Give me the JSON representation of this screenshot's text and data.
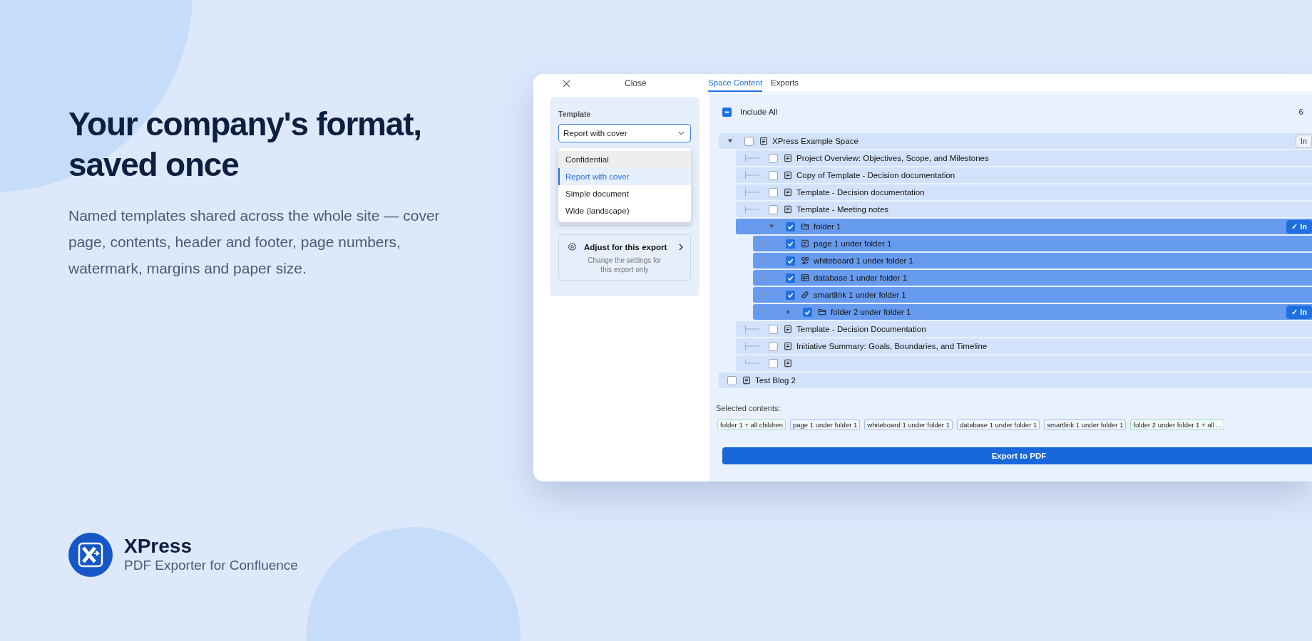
{
  "hero": {
    "title": "Your company's format, saved once",
    "text": "Named templates shared across the whole site — cover page, contents, header and footer, page numbers, watermark, margins and paper size."
  },
  "brand": {
    "name": "XPress",
    "subtitle": "PDF Exporter for Confluence"
  },
  "sidebar": {
    "close_label": "Close",
    "template_label": "Template",
    "template_value": "Report with cover",
    "options": [
      {
        "label": "Confidential",
        "selected": false,
        "hovered": true
      },
      {
        "label": "Report with cover",
        "selected": true,
        "hovered": false
      },
      {
        "label": "Simple document",
        "selected": false,
        "hovered": false
      },
      {
        "label": "Wide (landscape)",
        "selected": false,
        "hovered": false
      }
    ],
    "adjust": {
      "title": "Adjust for this export",
      "text": "Change the settings for this export only"
    }
  },
  "tabs": [
    {
      "label": "Space Content",
      "selected": true
    },
    {
      "label": "Exports",
      "selected": false
    }
  ],
  "include_all": {
    "label": "Include All",
    "mixed": true,
    "count": "6"
  },
  "tree": [
    {
      "title": "XPress Example Space",
      "kind": "page",
      "checked": false,
      "expanded": true,
      "include_button": {
        "label": "In",
        "on": false
      },
      "children": [
        {
          "title": "Project Overview: Objectives, Scope, and Milestones",
          "kind": "page",
          "checked": false
        },
        {
          "title": "Copy of Template - Decision documentation",
          "kind": "page",
          "checked": false
        },
        {
          "title": "Template - Decision documentation",
          "kind": "page",
          "checked": false
        },
        {
          "title": "Template - Meeting notes",
          "kind": "page",
          "checked": false
        },
        {
          "title": "folder 1",
          "kind": "folder",
          "checked": true,
          "expanded": true,
          "include_button": {
            "label": "✓ In",
            "on": true
          },
          "children": [
            {
              "title": "page 1 under folder 1",
              "kind": "page",
              "checked": true
            },
            {
              "title": "whiteboard 1 under folder 1",
              "kind": "whiteboard",
              "checked": true
            },
            {
              "title": "database 1 under folder 1",
              "kind": "database",
              "checked": true
            },
            {
              "title": "smartlink 1 under folder 1",
              "kind": "smartlink",
              "checked": true
            },
            {
              "title": "folder 2 under folder 1",
              "kind": "folder",
              "checked": true,
              "expanded": false,
              "include_button": {
                "label": "✓ In",
                "on": true
              }
            }
          ]
        },
        {
          "title": "Template - Decision Documentation",
          "kind": "page",
          "checked": false
        },
        {
          "title": "Initiative Summary: Goals, Boundaries, and Timeline",
          "kind": "page",
          "checked": false
        },
        {
          "kind": "page",
          "checked": false
        }
      ]
    },
    {
      "title": "Test Blog 2",
      "kind": "page",
      "checked": false
    }
  ],
  "selected_contents": {
    "label": "Selected contents:",
    "tags": [
      {
        "label": "folder 1 + all children",
        "kind": "subtree"
      },
      {
        "label": "page 1 under folder 1",
        "kind": "item"
      },
      {
        "label": "whiteboard 1 under folder 1",
        "kind": "item"
      },
      {
        "label": "database 1 under folder 1",
        "kind": "item"
      },
      {
        "label": "smartlink 1 under folder 1",
        "kind": "item"
      },
      {
        "label": "folder 2 under folder 1 + all ...",
        "kind": "subtree"
      }
    ]
  },
  "export_button": "Export to PDF"
}
